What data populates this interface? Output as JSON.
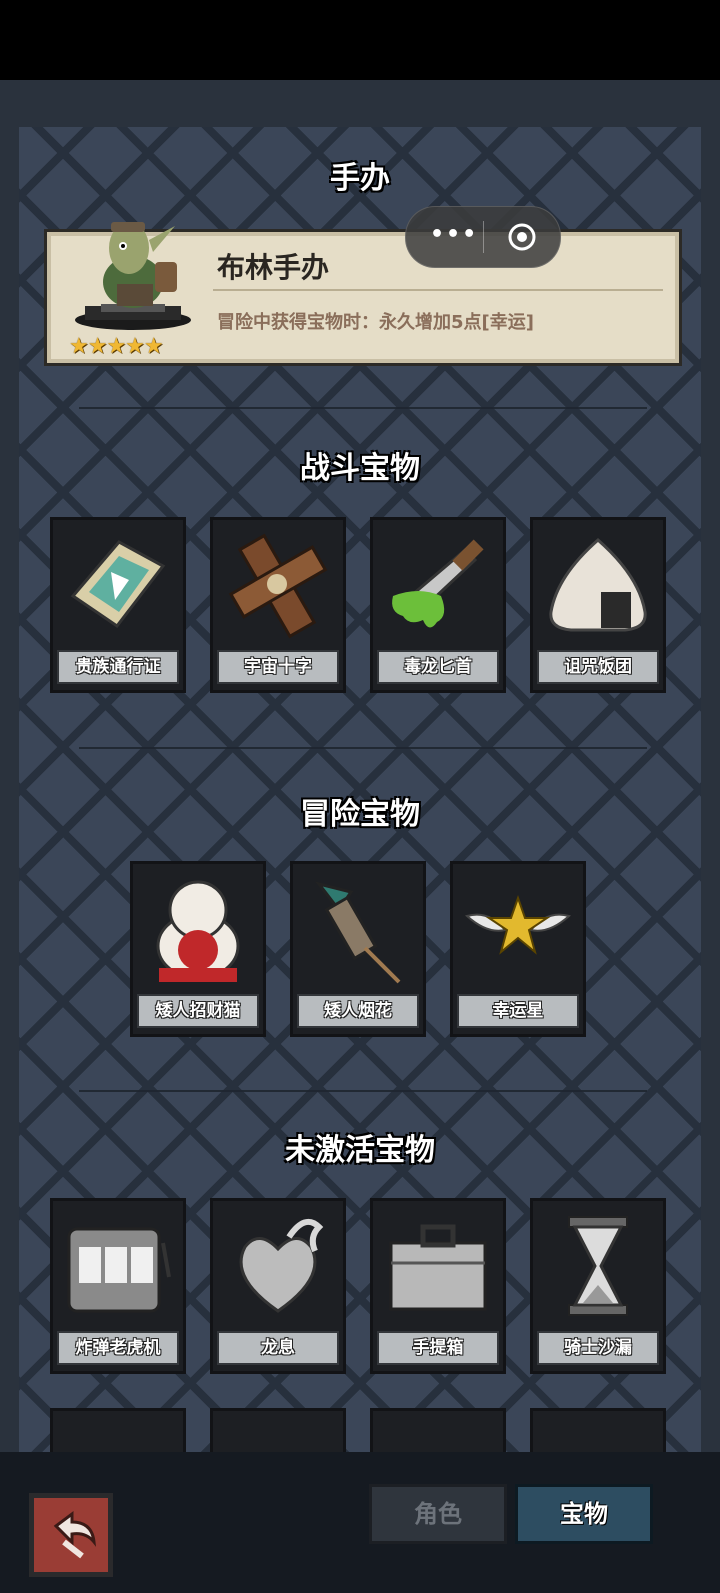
{
  "figure_section": {
    "title": "手办",
    "name": "布林手办",
    "effect": "冒险中获得宝物时：永久增加5点[幸运]",
    "stars": "★★★★★"
  },
  "sections": [
    {
      "title": "战斗宝物",
      "items": [
        {
          "label": "贵族通行证",
          "icon": "card-icon"
        },
        {
          "label": "宇宙十字",
          "icon": "wooden-cross-icon"
        },
        {
          "label": "毒龙匕首",
          "icon": "poison-dagger-icon"
        },
        {
          "label": "诅咒饭团",
          "icon": "rice-ball-icon"
        }
      ]
    },
    {
      "title": "冒险宝物",
      "items": [
        {
          "label": "矮人招财猫",
          "icon": "lucky-cat-icon"
        },
        {
          "label": "矮人烟花",
          "icon": "firework-icon"
        },
        {
          "label": "幸运星",
          "icon": "winged-star-icon"
        }
      ]
    },
    {
      "title": "未激活宝物",
      "items": [
        {
          "label": "炸弹老虎机",
          "icon": "slot-machine-icon"
        },
        {
          "label": "龙息",
          "icon": "dragon-heart-icon"
        },
        {
          "label": "手提箱",
          "icon": "suitcase-icon"
        },
        {
          "label": "骑士沙漏",
          "icon": "hourglass-icon"
        }
      ]
    }
  ],
  "capsule": {
    "more": "•••"
  },
  "tabs": {
    "role": "角色",
    "treasure": "宝物"
  },
  "colors": {
    "panel": "#3b4658",
    "card": "#e5ddc7",
    "accent": "#2d4d61",
    "star": "#f0b833"
  }
}
